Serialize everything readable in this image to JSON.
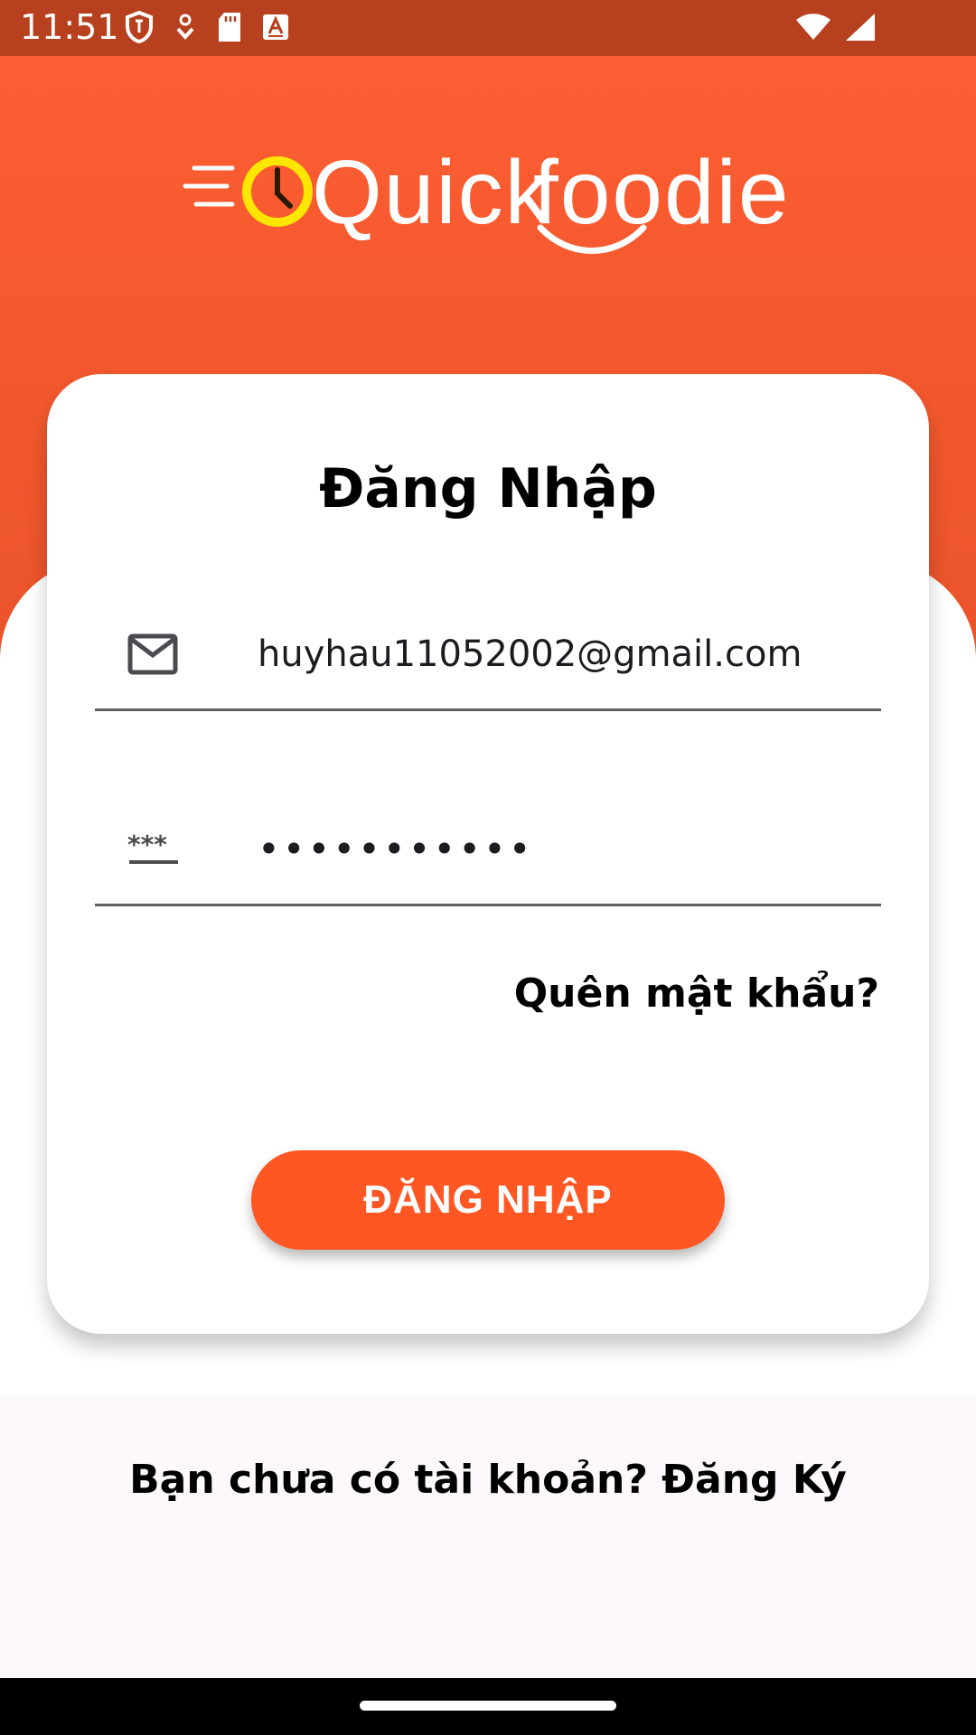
{
  "status_bar": {
    "time": "11:51",
    "left_icons": [
      "shield-icon",
      "download-icon",
      "sd-card-icon",
      "a11y-font-icon"
    ],
    "right_icons": [
      "wifi-icon",
      "signal-icon"
    ]
  },
  "brand": {
    "logo_part1": "Quick",
    "logo_part2": "foodie",
    "accent_yellow": "#ffe600"
  },
  "login": {
    "title": "Đăng Nhập",
    "email_value": "huyhau11052002@gmail.com",
    "password_value": "•••••••••••",
    "forgot_label": "Quên mật khẩu?",
    "submit_label": "ĐĂNG NHẬP"
  },
  "signup": {
    "text": "Bạn chưa có tài khoản? Đăng Ký"
  },
  "colors": {
    "primary": "#fe5724",
    "header_gradient_top": "#fe5e34",
    "status_bar": "#b7401f"
  }
}
